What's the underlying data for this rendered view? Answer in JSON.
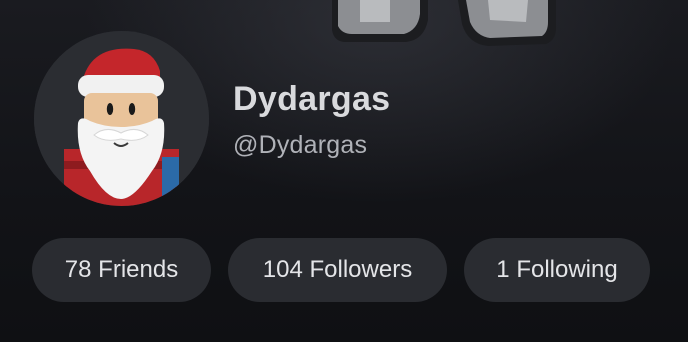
{
  "profile": {
    "display_name": "Dydargas",
    "username": "@Dydargas",
    "avatar_icon": "santa-avatar-icon"
  },
  "stats": {
    "friends_label": "78 Friends",
    "followers_label": "104 Followers",
    "following_label": "1 Following"
  },
  "colors": {
    "background": "#101114",
    "pill": "#2a2c31",
    "display_name": "#d9dadd",
    "username": "#b0b2b8"
  }
}
